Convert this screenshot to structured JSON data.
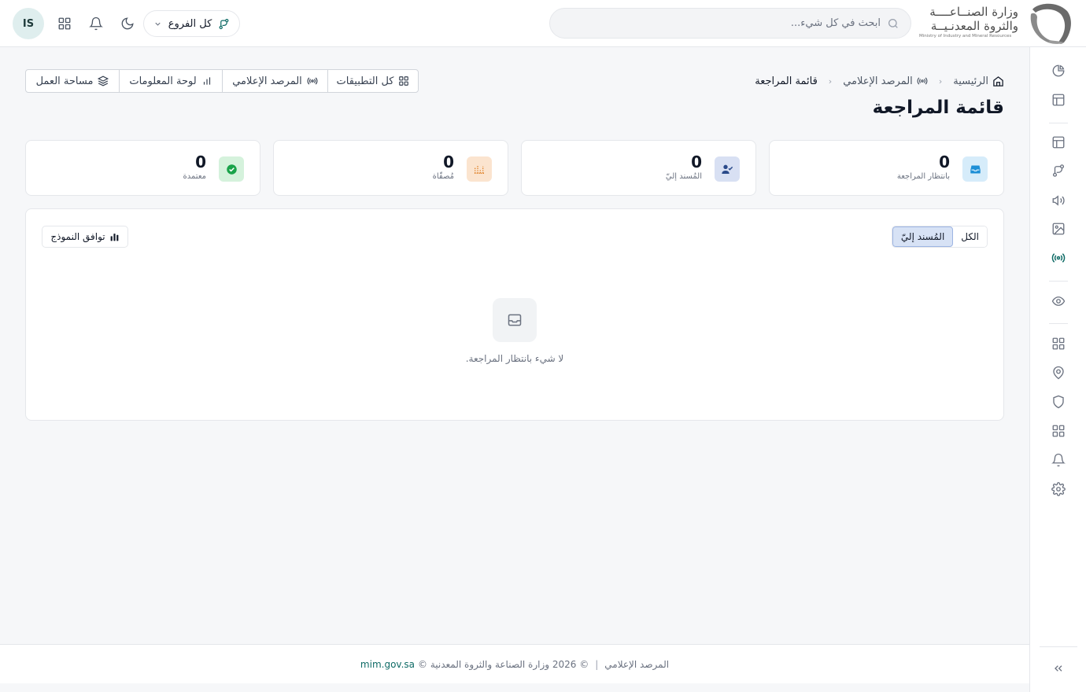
{
  "header": {
    "avatar_initials": "IS",
    "branch_label": "كل الفروع",
    "search_placeholder": "ابحث في كل شيء...",
    "logo_line1": "وزارة الصنــاعــــة",
    "logo_line2": "والثروة المعدنـيــة",
    "logo_line3": "Ministry of Industry and Mineral Resources"
  },
  "breadcrumb": {
    "home": "الرئيسية",
    "section": "المرصد الإعلامي",
    "current": "قائمة المراجعة"
  },
  "page_title": "قائمة المراجعة",
  "app_bar": {
    "all_apps": "كل التطبيقات",
    "media_monitor": "المرصد الإعلامي",
    "dashboard": "لوحة المعلومات",
    "workspace": "مساحة العمل"
  },
  "stats": [
    {
      "value": "0",
      "label": "بانتظار المراجعة",
      "icon": "inbox-icon",
      "color": "#1e8fd6"
    },
    {
      "value": "0",
      "label": "المُسند إليّ",
      "icon": "user-check-icon",
      "color": "#2a4a8a"
    },
    {
      "value": "0",
      "label": "مُصفّاة",
      "icon": "filter-icon",
      "color": "#e0822a"
    },
    {
      "value": "0",
      "label": "معتمدة",
      "icon": "check-circle-icon",
      "color": "#1aa34a"
    }
  ],
  "panel": {
    "tab_all": "الكل",
    "tab_assigned": "المُسند إليّ",
    "compat_button": "توافق النموذج",
    "empty_message": "لا شيء بانتظار المراجعة."
  },
  "footer": {
    "app_name": "المرصد الإعلامي",
    "separator": "|",
    "copyright": "© 2026 وزارة الصناعة والثروة المعدنية ©",
    "site": "mim.gov.sa"
  },
  "colors": {
    "accent": "#0f6b66",
    "active_tab_bg": "#d7e2f5"
  }
}
